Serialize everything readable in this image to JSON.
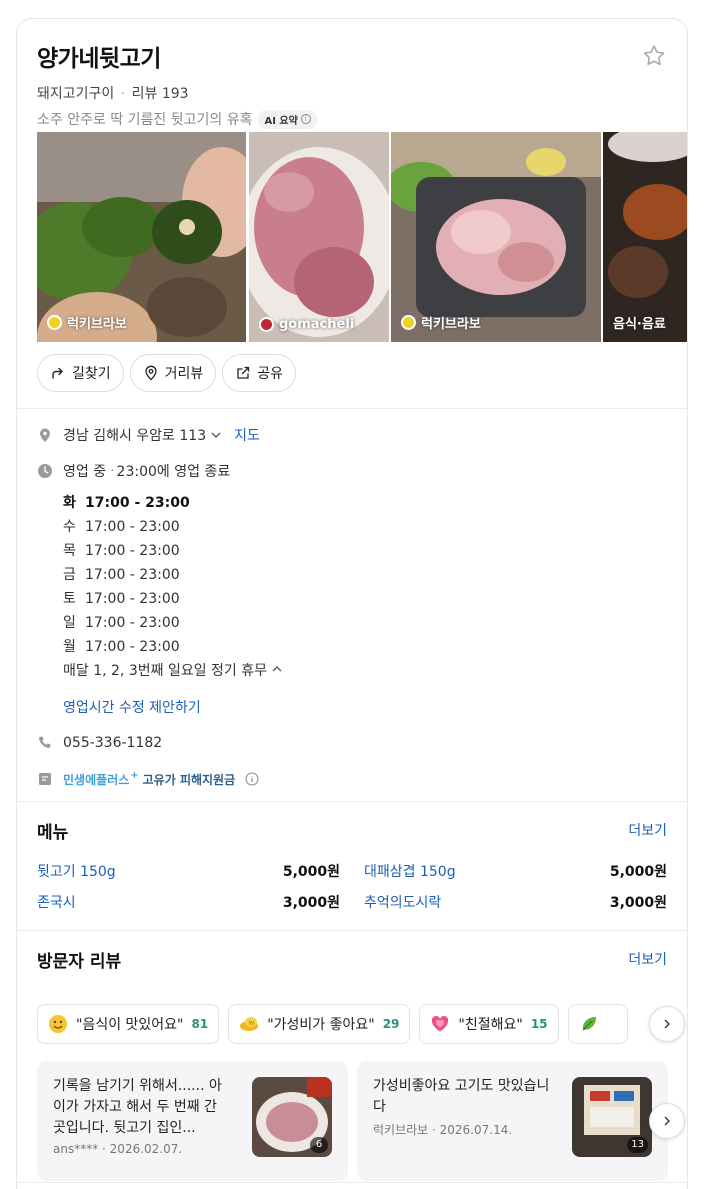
{
  "place": {
    "name": "양가네뒷고기",
    "category": "돼지고기구이",
    "review_label": "리뷰 193",
    "summary": "소주 안주로 딱 기름진 뒷고기의 유혹",
    "ai_badge": "AI 요약"
  },
  "photos": [
    {
      "caption": "럭키브라보"
    },
    {
      "caption": "gomacheli"
    },
    {
      "caption": "럭키브라보"
    },
    {
      "caption": "음식·음료"
    }
  ],
  "actions": {
    "directions": "길찾기",
    "street_view": "거리뷰",
    "share": "공유"
  },
  "info": {
    "address": "경남 김해시 우암로 113",
    "map_link": "지도",
    "status": "영업 중",
    "status_detail": "23:00에 영업 종료",
    "hours": [
      {
        "day": "화",
        "time": "17:00 - 23:00",
        "today": true
      },
      {
        "day": "수",
        "time": "17:00 - 23:00",
        "today": false
      },
      {
        "day": "목",
        "time": "17:00 - 23:00",
        "today": false
      },
      {
        "day": "금",
        "time": "17:00 - 23:00",
        "today": false
      },
      {
        "day": "토",
        "time": "17:00 - 23:00",
        "today": false
      },
      {
        "day": "일",
        "time": "17:00 - 23:00",
        "today": false
      },
      {
        "day": "월",
        "time": "17:00 - 23:00",
        "today": false
      }
    ],
    "holiday": "매달 1, 2, 3번째 일요일 정기 휴무",
    "edit_hours": "영업시간 수정 제안하기",
    "phone": "055-336-1182",
    "promo_brand": "민생에플러스",
    "promo_text": "고유가 피해지원금"
  },
  "menu": {
    "title": "메뉴",
    "more": "더보기",
    "items": [
      {
        "name": "뒷고기 150g",
        "price": "5,000원"
      },
      {
        "name": "대패삼겹 150g",
        "price": "5,000원"
      },
      {
        "name": "존국시",
        "price": "3,000원"
      },
      {
        "name": "추억의도시락",
        "price": "3,000원"
      }
    ]
  },
  "reviews": {
    "title": "방문자 리뷰",
    "more": "더보기",
    "keywords": [
      {
        "label": "\"음식이 맛있어요\"",
        "count": "81"
      },
      {
        "label": "\"가성비가 좋아요\"",
        "count": "29"
      },
      {
        "label": "\"친절해요\"",
        "count": "15"
      }
    ],
    "cards": [
      {
        "text": "기록을 남기기 위해서...... 아이가 가자고 해서 두 번째 간 곳입니다. 뒷고기 집인...",
        "author": "ans****",
        "date": "2026.02.07.",
        "photo_count": "6"
      },
      {
        "text": "가성비좋아요 고기도 맛있습니다",
        "author": "럭키브라보",
        "date": "2026.07.14.",
        "photo_count": "13"
      }
    ]
  },
  "colors": {
    "link": "#1d5fb8",
    "count": "#2a8f7d",
    "star": "#a6a6a6"
  }
}
